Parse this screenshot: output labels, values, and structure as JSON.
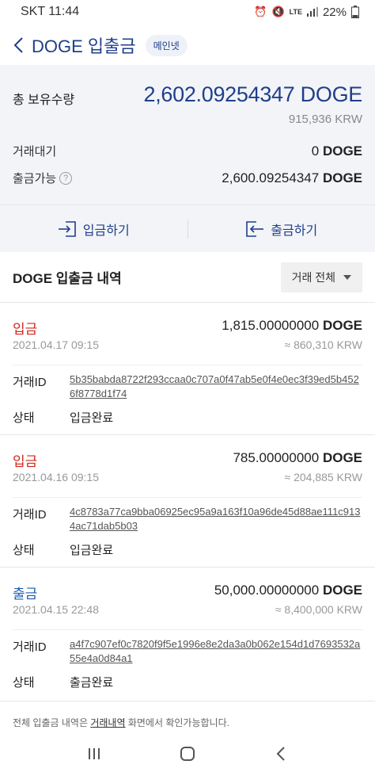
{
  "status_bar": {
    "carrier_time": "SKT 11:44",
    "network": "LTE",
    "battery": "22%"
  },
  "header": {
    "title": "DOGE 입출금",
    "network_badge": "메인넷"
  },
  "summary": {
    "total_label": "총 보유수량",
    "total_value": "2,602.09254347 DOGE",
    "total_krw": "915,936 KRW",
    "pending_label": "거래대기",
    "pending_amount": "0",
    "pending_unit": "DOGE",
    "withdrawable_label": "출금가능",
    "withdrawable_amount": "2,600.09254347",
    "withdrawable_unit": "DOGE",
    "help_icon": "?"
  },
  "actions": {
    "deposit_label": "입금하기",
    "withdraw_label": "출금하기"
  },
  "history": {
    "title": "DOGE 입출금 내역",
    "filter_label": "거래 전체"
  },
  "labels": {
    "txid": "거래ID",
    "status": "상태"
  },
  "transactions": [
    {
      "type": "입금",
      "amount": "1,815.00000000",
      "unit": "DOGE",
      "date": "2021.04.17 09:15",
      "krw": "≈ 860,310 KRW",
      "txid": "5b35babda8722f293ccaa0c707a0f47ab5e0f4e0ec3f39ed5b4526f8778d1f74",
      "status": "입금완료"
    },
    {
      "type": "입금",
      "amount": "785.00000000",
      "unit": "DOGE",
      "date": "2021.04.16 09:15",
      "krw": "≈ 204,885 KRW",
      "txid": "4c8783a77ca9bba06925ec95a9a163f10a96de45d88ae111c9134ac71dab5b03",
      "status": "입금완료"
    },
    {
      "type": "출금",
      "amount": "50,000.00000000",
      "unit": "DOGE",
      "date": "2021.04.15 22:48",
      "krw": "≈ 8,400,000 KRW",
      "txid": "a4f7c907ef0c7820f9f5e1996e8e2da3a0b062e154d1d7693532a55e4a0d84a1",
      "status": "출금완료"
    }
  ],
  "footer": {
    "note_prefix": "전체 입출금 내역은 ",
    "note_link": "거래내역",
    "note_suffix": " 화면에서 확인가능합니다."
  },
  "colors": {
    "brand": "#1e3f8a",
    "deposit": "#d0271d",
    "withdraw": "#1d5bb0",
    "summary_bg": "#f3f4f8"
  },
  "icons": [
    "back-chevron-icon",
    "alarm-icon",
    "mute-icon",
    "signal-icon",
    "deposit-icon",
    "withdraw-icon",
    "caret-down-icon",
    "recents-icon",
    "home-icon",
    "nav-back-icon"
  ]
}
